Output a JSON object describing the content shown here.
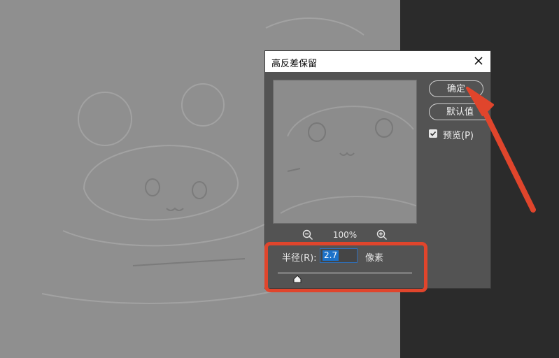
{
  "dialog": {
    "title": "高反差保留",
    "ok_label": "确定",
    "default_label": "默认值",
    "preview_label": "预览(P)",
    "preview_checked": true,
    "zoom_level": "100%",
    "radius_label": "半径(R):",
    "radius_value": "2.7",
    "radius_unit": "像素"
  },
  "icons": {
    "close": "close-icon",
    "zoom_out": "zoom-out-icon",
    "zoom_in": "zoom-in-icon",
    "checkbox": "checkmark-icon",
    "slider": "slider-thumb-icon"
  },
  "colors": {
    "annotation": "#e0452c",
    "selection": "#1d72c9",
    "canvas": "#8f8f8f",
    "dialog_bg": "#535353"
  }
}
